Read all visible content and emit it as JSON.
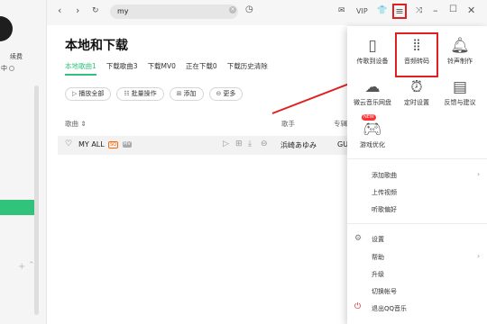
{
  "sidebar": {
    "vip_text": "续费",
    "online_text": "中"
  },
  "topbar": {
    "search_value": "my",
    "vip_label": "VIP",
    "back": "‹",
    "forward": "›"
  },
  "main": {
    "title": "本地和下载",
    "tabs": [
      "本地歌曲1",
      "下载歌曲3",
      "下载MV0",
      "正在下载0",
      "下载历史清除"
    ],
    "actions": {
      "play_all": "播放全部",
      "batch": "批量操作",
      "add": "添加",
      "more": "更多"
    },
    "columns": {
      "song": "歌曲 ⇕",
      "singer": "歌手",
      "album": "专辑"
    },
    "rows": [
      {
        "title": "MY ALL",
        "badge_sq": "SQ",
        "badge_mv": "MV",
        "singer": "浜崎あゆみ",
        "album": "GU"
      }
    ]
  },
  "menu": {
    "grid": [
      {
        "label": "传歌到设备",
        "icon": "phone-icon"
      },
      {
        "label": "音频转码",
        "icon": "audio-wave-icon"
      },
      {
        "label": "铃声制作",
        "icon": "bell-icon"
      },
      {
        "label": "微云音乐网盘",
        "icon": "cloud-icon"
      },
      {
        "label": "定时设置",
        "icon": "alarm-clock-icon"
      },
      {
        "label": "反馈与建议",
        "icon": "feedback-icon"
      },
      {
        "label": "游戏优化",
        "icon": "gamepad-icon"
      }
    ],
    "new_badge": "NEW",
    "list_a": [
      {
        "label": "添加歌曲",
        "arrow": true
      },
      {
        "label": "上传视频",
        "arrow": false
      },
      {
        "label": "听歌偏好",
        "arrow": false
      }
    ],
    "list_b": [
      {
        "label": "设置",
        "icon": "gear-icon"
      },
      {
        "label": "帮助",
        "arrow": true
      },
      {
        "label": "升级"
      },
      {
        "label": "切换帐号"
      },
      {
        "label": "退出QQ音乐",
        "icon": "power-icon"
      }
    ]
  },
  "colors": {
    "accent": "#31c27c",
    "annotation": "#e02020"
  }
}
